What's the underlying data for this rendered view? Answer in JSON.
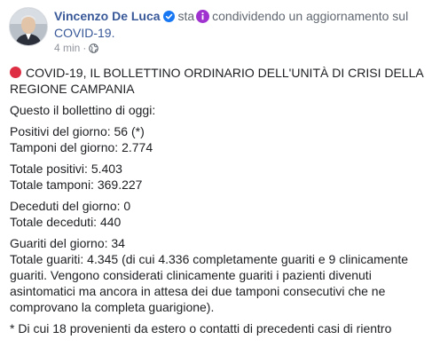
{
  "post": {
    "author": "Vincenzo De Luca",
    "activity_verb": "sta",
    "activity_text": "condividendo un aggiornamento sul",
    "activity_topic": "COVID-19.",
    "time": "4 min",
    "separator": "·",
    "headline": "COVID-19, IL BOLLETTINO ORDINARIO DELL'UNITÀ DI CRISI DELLA REGIONE CAMPANIA",
    "intro": "Questo il bollettino di oggi:",
    "lines": {
      "positivi": "Positivi del giorno: 56 (*)",
      "tamponi": "Tamponi del giorno: 2.774",
      "totale_positivi": "Totale positivi: 5.403",
      "totale_tamponi": "Totale tamponi: 369.227",
      "deceduti": "Deceduti del giorno: 0",
      "totale_deceduti": "Totale deceduti: 440",
      "guariti": "Guariti del giorno: 34",
      "totale_guariti": "Totale guariti: 4.345 (di cui 4.336 completamente guariti e 9 clinicamente guariti. Vengono considerati clinicamente guariti i pazienti divenuti asintomatici ma ancora in attesa dei due tamponi consecutivi che ne comprovano la completa guarigione).",
      "nota": "* Di cui 18 provenienti da estero o contatti di precedenti casi di rientro"
    },
    "icons": {
      "verified": "verified-badge-icon",
      "activity": "info-icon",
      "audience": "globe-icon",
      "bullet": "red-circle-icon"
    },
    "colors": {
      "link": "#385898",
      "meta": "#90949c",
      "verified": "#1877f2",
      "activity_icon": "#a033d0",
      "red_circle": "#dd2e44"
    }
  }
}
